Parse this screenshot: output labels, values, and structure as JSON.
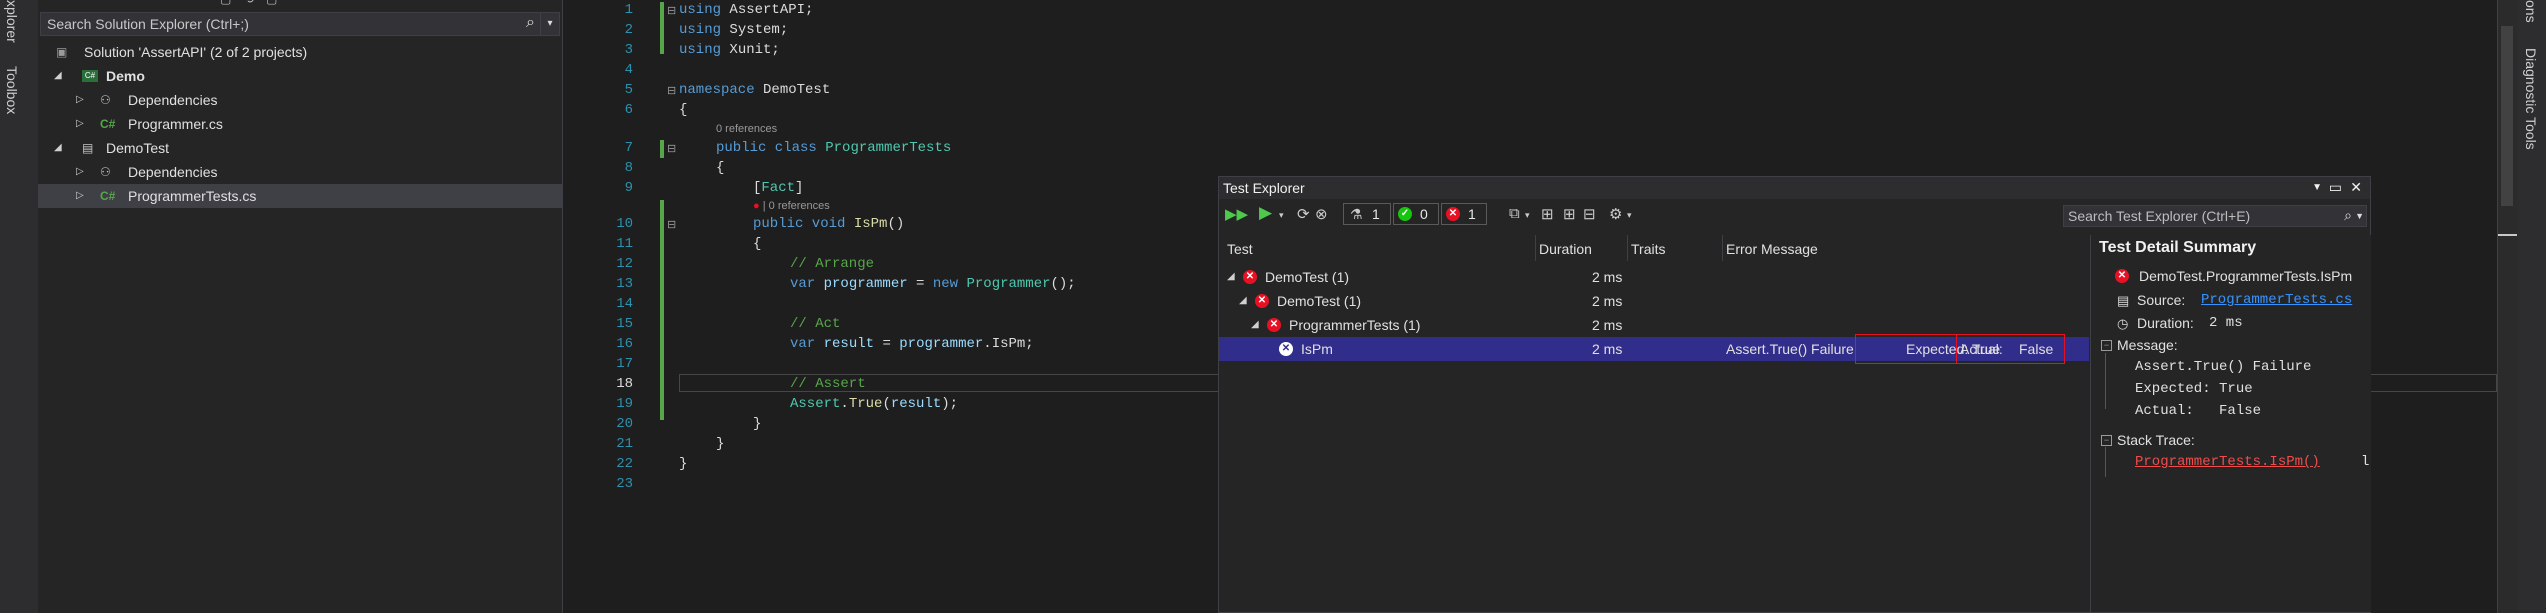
{
  "left_strip": {
    "tabs": [
      "xplorer",
      "Toolbox"
    ]
  },
  "solution_explorer": {
    "search_placeholder": "Search Solution Explorer (Ctrl+;)",
    "items": [
      {
        "label": "Solution 'AssertAPI' (2 of 2 projects)",
        "icon": "solution-icon"
      },
      {
        "label": "Demo",
        "icon": "csharp-project-icon",
        "bold": true
      },
      {
        "label": "Dependencies",
        "icon": "dependencies-icon"
      },
      {
        "label": "Programmer.cs",
        "icon": "csharp-file-icon",
        "prefix": "C#"
      },
      {
        "label": "DemoTest",
        "icon": "test-project-icon"
      },
      {
        "label": "Dependencies",
        "icon": "dependencies-icon"
      },
      {
        "label": "ProgrammerTests.cs",
        "icon": "csharp-file-icon",
        "prefix": "C#"
      }
    ]
  },
  "editor": {
    "line_numbers": [
      "1",
      "2",
      "3",
      "4",
      "5",
      "6",
      "7",
      "8",
      "9",
      "10",
      "11",
      "12",
      "13",
      "14",
      "15",
      "16",
      "17",
      "18",
      "19",
      "20",
      "21",
      "22",
      "23"
    ],
    "code": {
      "l1_kw": "using",
      "l1_rest": " AssertAPI;",
      "l2_kw": "using",
      "l2_rest": " System;",
      "l3_kw": "using",
      "l3_rest": " Xunit;",
      "l5_kw": "namespace",
      "l5_rest": " DemoTest",
      "l6": "{",
      "refs_class": "0 references",
      "l7_kw": "public class",
      "l7_type": "ProgrammerTests",
      "l8": "{",
      "l9_attr": "Fact",
      "refs_method": "0 references",
      "l10_kw": "public void",
      "l10_name": "IsPm",
      "l10_rest": "()",
      "l11": "{",
      "l12": "// Arrange",
      "l13_kw": "var",
      "l13_var": "programmer",
      "l13_eq": " = ",
      "l13_new": "new",
      "l13_type": "Programmer",
      "l13_end": "();",
      "l15": "// Act",
      "l16_kw": "var",
      "l16_var": "result",
      "l16_eq": " = ",
      "l16_obj": "programmer",
      "l16_dot": ".",
      "l16_prop": "IsPm",
      "l16_end": ";",
      "l18": "// Assert",
      "l19_type": "Assert",
      "l19_dot": ".",
      "l19_method": "True",
      "l19_open": "(",
      "l19_arg": "result",
      "l19_close": ");",
      "l20": "}",
      "l21": "}",
      "l22": "}"
    }
  },
  "right_strip": {
    "tabs": [
      "ons",
      "Diagnostic Tools"
    ]
  },
  "test_explorer": {
    "title": "Test Explorer",
    "toolbar": {
      "total_count": "1",
      "passed_count": "0",
      "failed_count": "1"
    },
    "search_placeholder": "Search Test Explorer (Ctrl+E)",
    "columns": [
      "Test",
      "Duration",
      "Traits",
      "Error Message"
    ],
    "rows": [
      {
        "name": "DemoTest (1)",
        "duration": "2 ms",
        "error": ""
      },
      {
        "name": "DemoTest (1)",
        "duration": "2 ms",
        "error": ""
      },
      {
        "name": "ProgrammerTests (1)",
        "duration": "2 ms",
        "error": ""
      },
      {
        "name": "IsPm",
        "duration": "2 ms",
        "error_a": "Assert.True() Failure",
        "error_b": "Expected: True",
        "error_c": "Actual:",
        "error_d": "False"
      }
    ],
    "detail": {
      "heading": "Test Detail Summary",
      "test_name": "DemoTest.ProgrammerTests.IsPm",
      "source_label": "Source:",
      "source_link": "ProgrammerTests.cs",
      "duration_label": "Duration:",
      "duration_value": "2 ms",
      "message_label": "Message:",
      "message_lines": [
        "Assert.True() Failure",
        "Expected: True",
        "Actual:   False"
      ],
      "stack_label": "Stack Trace:",
      "stack_link": "ProgrammerTests.IsPm()",
      "stack_tail": "l"
    }
  }
}
